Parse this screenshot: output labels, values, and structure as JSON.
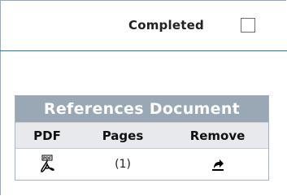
{
  "header": {
    "completed_label": "Completed"
  },
  "references": {
    "title": "References Document",
    "columns": [
      "PDF",
      "Pages",
      "Remove"
    ],
    "rows": [
      {
        "pdf_icon": "pdf-icon",
        "pages": "(1)",
        "remove_icon": "remove-icon"
      }
    ]
  }
}
